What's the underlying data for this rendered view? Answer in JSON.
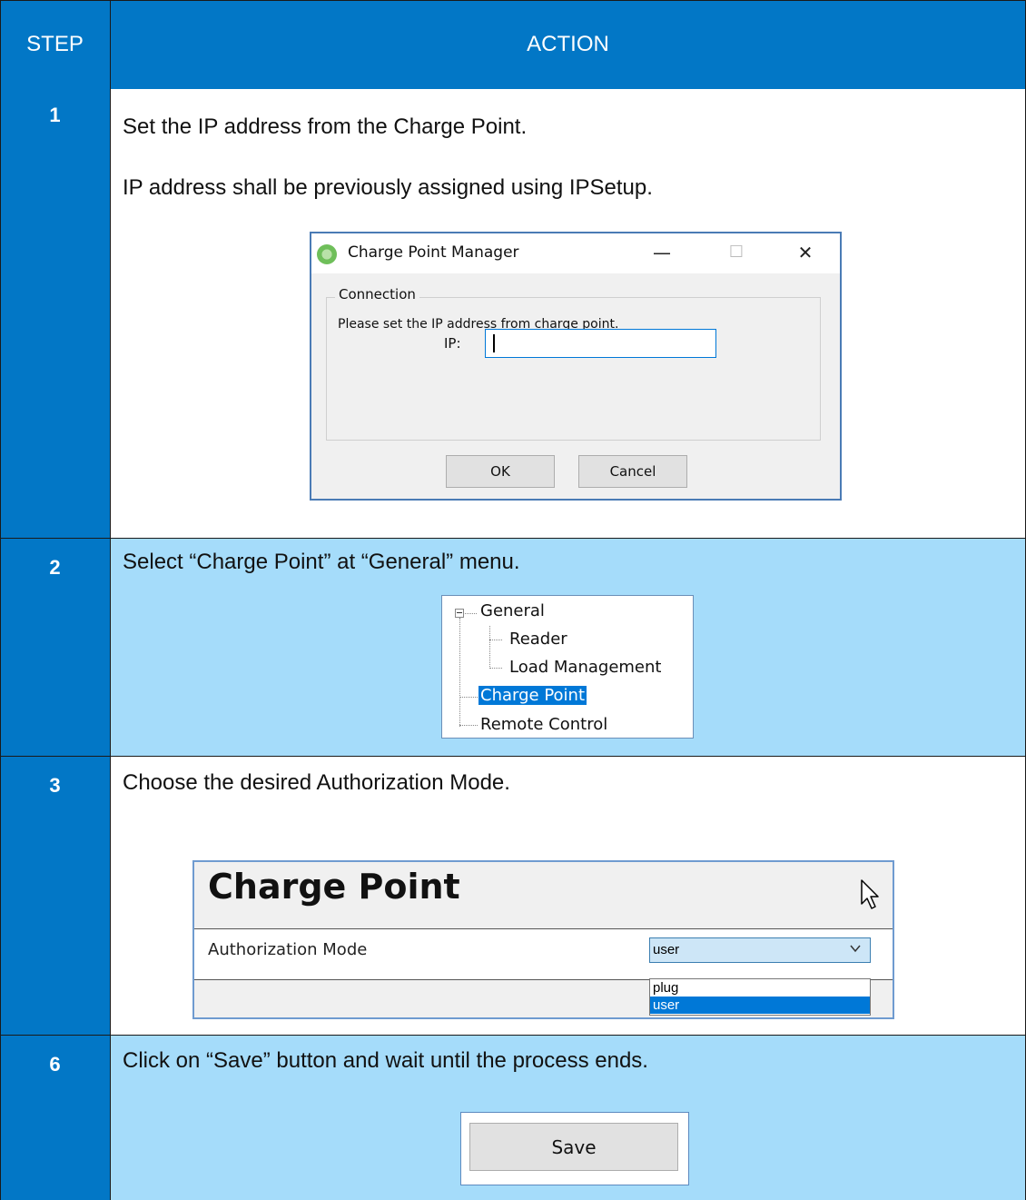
{
  "header": {
    "step_label": "STEP",
    "action_label": "ACTION"
  },
  "colors": {
    "header_bg": "#0277c6",
    "alt_row_bg": "#a5dcfa",
    "white_row_bg": "#ffffff"
  },
  "steps": [
    {
      "number": "1",
      "lines": [
        "Set the IP address from the Charge Point.",
        "IP address shall be previously assigned using IPSetup."
      ]
    },
    {
      "number": "2",
      "lines": [
        "Select “Charge Point” at “General” menu."
      ]
    },
    {
      "number": "3",
      "lines": [
        "Choose the desired Authorization Mode."
      ]
    },
    {
      "number": "6",
      "lines": [
        "Click on “Save” button and wait until the process ends."
      ]
    }
  ],
  "dialog": {
    "title": "Charge Point Manager",
    "app_icon": "charge-point-app-icon",
    "minimize_glyph": "—",
    "maximize_glyph": "☐",
    "close_glyph": "✕",
    "group_label": "Connection",
    "instruction": "Please set the IP address from charge point.",
    "ip_label": "IP:",
    "ip_value": "",
    "ok_label": "OK",
    "cancel_label": "Cancel"
  },
  "tree": {
    "items": [
      {
        "label": "General",
        "expanded": true
      },
      {
        "label": "Reader"
      },
      {
        "label": "Load Management"
      },
      {
        "label": "Charge Point",
        "selected": true
      },
      {
        "label": "Remote Control"
      }
    ]
  },
  "charge_point_panel": {
    "title": "Charge Point",
    "field_label": "Authorization Mode",
    "selected_value": "user",
    "options": [
      "plug",
      "user"
    ],
    "highlighted_option": "user"
  },
  "save": {
    "label": "Save"
  }
}
